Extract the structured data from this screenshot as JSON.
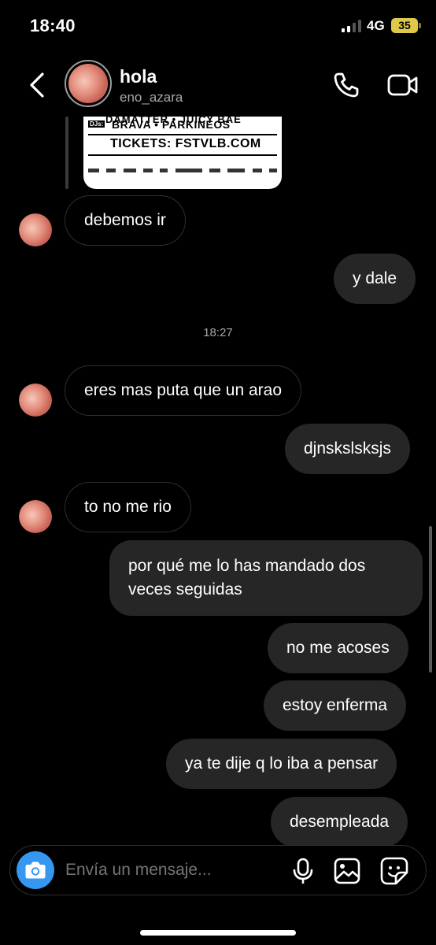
{
  "status": {
    "time": "18:40",
    "network": "4G",
    "battery": "35"
  },
  "header": {
    "name": "hola",
    "username": "eno_azara"
  },
  "shared_post": {
    "line1": "DAMATTER • JUICY BAE",
    "dj_tag": "DJs:",
    "line2": "BRAVA • PARKINEOS",
    "line3": "TICKETS: FSTVLB.COM"
  },
  "messages": [
    {
      "side": "in",
      "text": "debemos ir",
      "avatar": true
    },
    {
      "side": "out",
      "text": "y dale"
    },
    {
      "side": "in",
      "text": "eres mas puta que un arao",
      "avatar": true
    },
    {
      "side": "out",
      "text": "djnskslsksjs"
    },
    {
      "side": "in",
      "text": "to no me rio",
      "avatar": true
    },
    {
      "side": "out",
      "text": "por qué me lo has mandado dos veces seguidas"
    },
    {
      "side": "out",
      "text": "no me acoses"
    },
    {
      "side": "out",
      "text": "estoy enferma"
    },
    {
      "side": "out",
      "text": "ya te dije q lo iba a pensar"
    },
    {
      "side": "out",
      "text": "desempleada"
    }
  ],
  "timestamp": "18:27",
  "composer": {
    "placeholder": "Envía un mensaje..."
  },
  "colors": {
    "accent": "#3797f0",
    "outgoing_bubble": "#262626",
    "battery": "#e0c84a"
  }
}
